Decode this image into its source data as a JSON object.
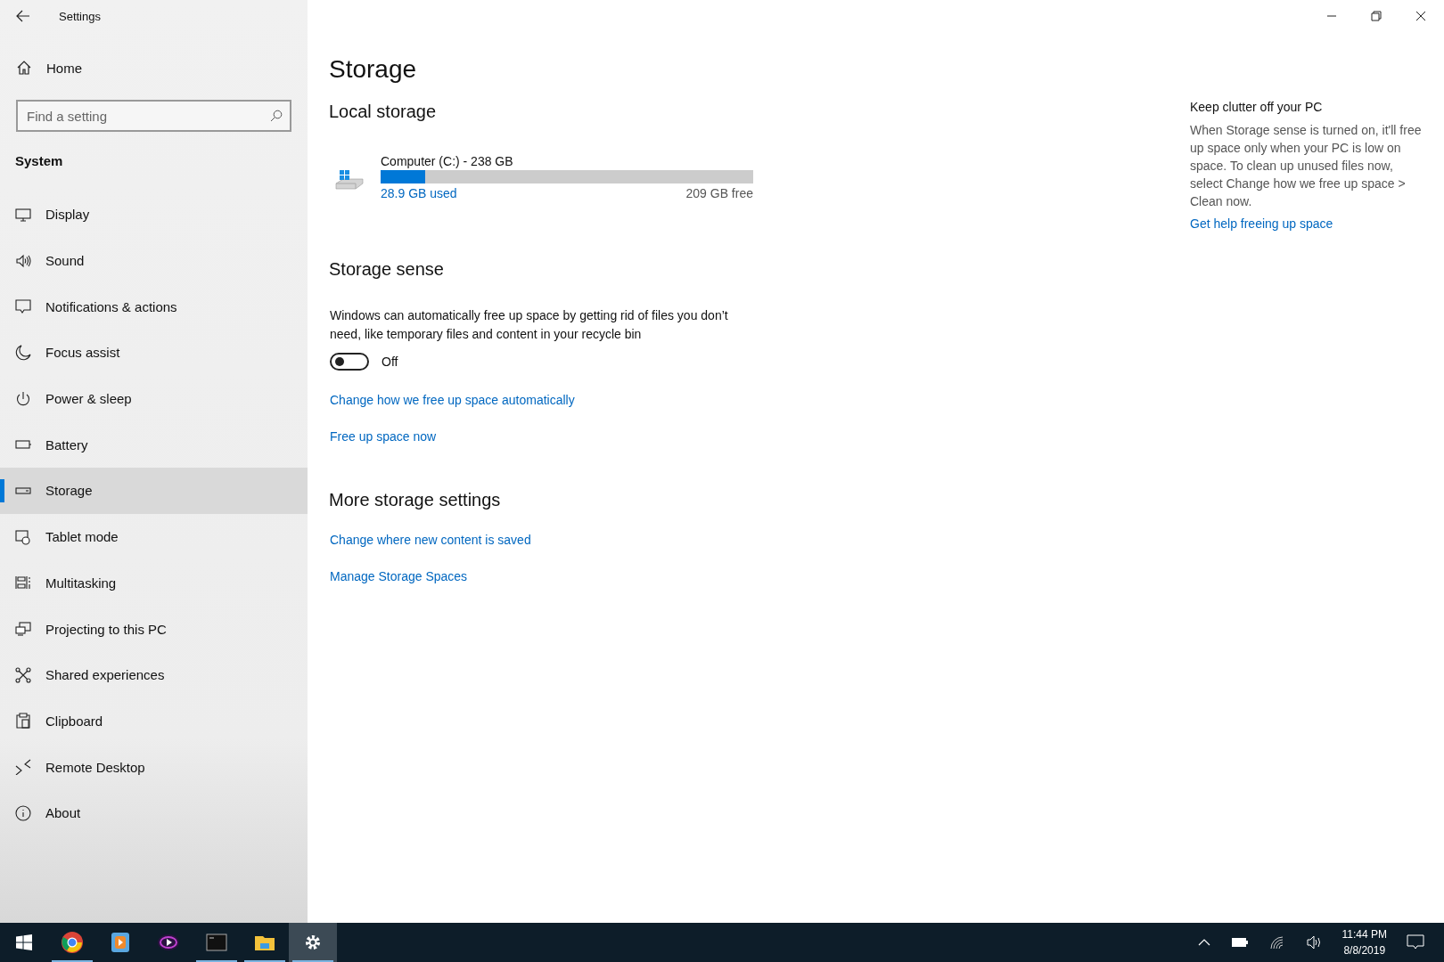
{
  "window": {
    "title": "Settings"
  },
  "sidebar": {
    "home": "Home",
    "search": {
      "placeholder": "Find a setting"
    },
    "section": "System",
    "items": [
      {
        "label": "Display",
        "selected": false
      },
      {
        "label": "Sound",
        "selected": false
      },
      {
        "label": "Notifications & actions",
        "selected": false
      },
      {
        "label": "Focus assist",
        "selected": false
      },
      {
        "label": "Power & sleep",
        "selected": false
      },
      {
        "label": "Battery",
        "selected": false
      },
      {
        "label": "Storage",
        "selected": true
      },
      {
        "label": "Tablet mode",
        "selected": false
      },
      {
        "label": "Multitasking",
        "selected": false
      },
      {
        "label": "Projecting to this PC",
        "selected": false
      },
      {
        "label": "Shared experiences",
        "selected": false
      },
      {
        "label": "Clipboard",
        "selected": false
      },
      {
        "label": "Remote Desktop",
        "selected": false
      },
      {
        "label": "About",
        "selected": false
      }
    ]
  },
  "page": {
    "title": "Storage",
    "local_storage": {
      "heading": "Local storage",
      "drive": {
        "name": "Computer (C:) - 238 GB",
        "level": 0.12,
        "used": "28.9 GB used",
        "free": "209 GB free"
      }
    },
    "storage_sense": {
      "heading": "Storage sense",
      "description": "Windows can automatically free up space by getting rid of files you don’t need, like temporary files and content in your recycle bin",
      "toggle": {
        "on": false,
        "label": "Off"
      },
      "links": [
        "Change how we free up space automatically",
        "Free up space now"
      ]
    },
    "more": {
      "heading": "More storage settings",
      "links": [
        "Change where new content is saved",
        "Manage Storage Spaces"
      ]
    }
  },
  "aside": {
    "heading": "Keep clutter off your PC",
    "text": "When Storage sense is turned on, it'll free up space only when your PC is low on space. To clean up unused files now, select Change how we free up space > Clean now.",
    "link": "Get help freeing up space"
  },
  "taskbar": {
    "apps": [
      {
        "running": true,
        "selected": false
      },
      {
        "running": false,
        "selected": false
      },
      {
        "running": false,
        "selected": false
      },
      {
        "running": true,
        "selected": false
      },
      {
        "running": true,
        "selected": false
      },
      {
        "running": true,
        "selected": true
      }
    ],
    "time": "11:44 PM",
    "date": "8/8/2019"
  }
}
